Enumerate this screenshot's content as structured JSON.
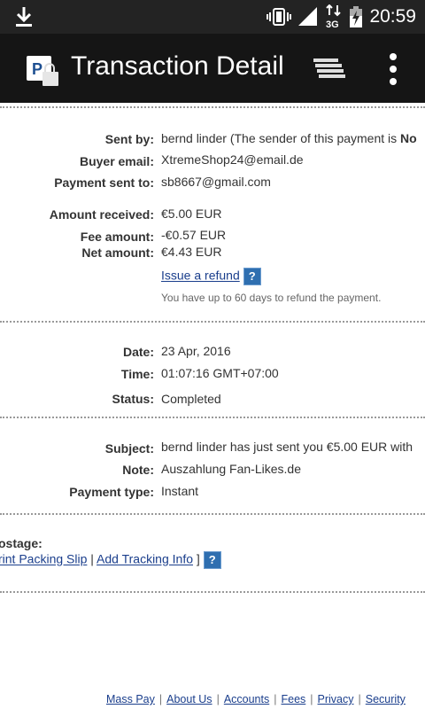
{
  "status_bar": {
    "time": "20:59"
  },
  "app_bar": {
    "title": "Transaction Detail"
  },
  "details": {
    "sent_by_label": "Sent by:",
    "sent_by_name": "bernd linder (The sender of this payment is ",
    "sent_by_suffix": "No",
    "buyer_email_label": "Buyer email:",
    "buyer_email": "XtremeShop24@email.de",
    "payment_sent_to_label": "Payment sent to:",
    "payment_sent_to": "sb8667@gmail.com",
    "amount_received_label": "Amount received:",
    "amount_received": "€5.00 EUR",
    "fee_amount_label": "Fee amount:",
    "fee_amount": "-€0.57 EUR",
    "net_amount_label": "Net amount:",
    "net_amount": "€4.43 EUR",
    "refund_link": "Issue a refund",
    "refund_note": "You have up to 60 days to refund the payment.",
    "date_label": "Date:",
    "date": "23 Apr, 2016",
    "time_label": "Time:",
    "time": "01:07:16 GMT+07:00",
    "status_label": "Status:",
    "status": "Completed",
    "subject_label": "Subject:",
    "subject": "bernd linder has just sent you €5.00 EUR with",
    "note_label": "Note:",
    "note": "Auszahlung Fan-Likes.de",
    "payment_type_label": "Payment type:",
    "payment_type": "Instant",
    "postage_label": "ostage:",
    "print_packing_slip": "rint Packing Slip",
    "separator": "|",
    "add_tracking_info": "Add Tracking Info",
    "close_bracket": "]"
  },
  "help_icon": "?",
  "footer": {
    "links": [
      "Mass Pay",
      "About Us",
      "Accounts",
      "Fees",
      "Privacy",
      "Security"
    ],
    "separator": "|"
  },
  "colors": {
    "link": "#1a3e8c",
    "help_badge": "#2f6fb0",
    "app_bar": "#151515",
    "status_bar": "#232323"
  }
}
